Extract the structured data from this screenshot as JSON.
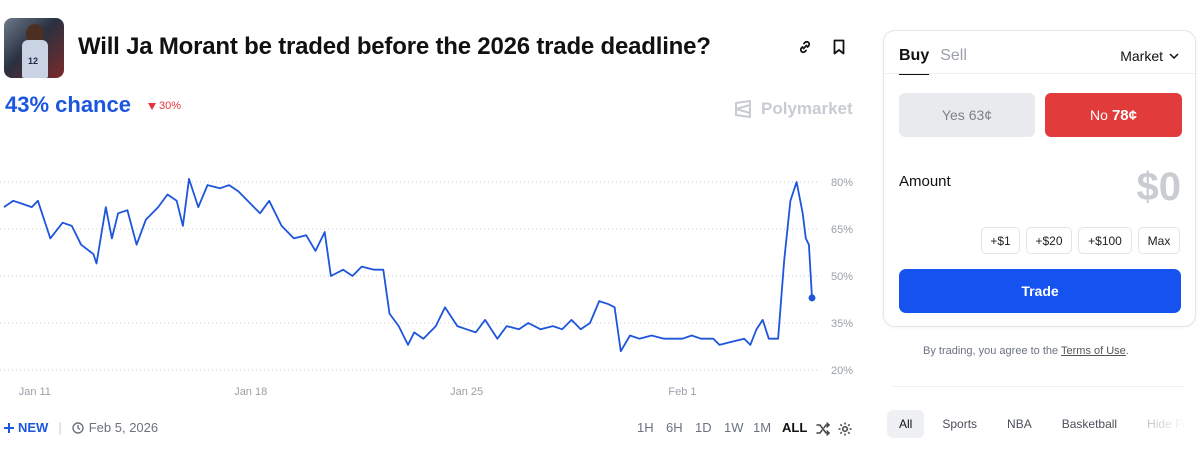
{
  "market": {
    "title": "Will Ja Morant be traded before the 2026 trade deadline?",
    "chance": "43% chance",
    "change": "30%",
    "brand": "Polymarket",
    "jersey_number": "12"
  },
  "footer": {
    "new_label": "NEW",
    "date": "Feb 5, 2026",
    "ranges": [
      "1H",
      "6H",
      "1D",
      "1W",
      "1M",
      "ALL"
    ],
    "active_range": "ALL"
  },
  "panel": {
    "buy": "Buy",
    "sell": "Sell",
    "order_type": "Market",
    "yes_label": "Yes",
    "yes_price": "63¢",
    "no_label": "No",
    "no_price": "78¢",
    "amount_label": "Amount",
    "amount_value": "$0",
    "quick_amounts": [
      "+$1",
      "+$20",
      "+$100",
      "Max"
    ],
    "trade_label": "Trade"
  },
  "terms": {
    "text": "By trading, you agree to the ",
    "link": "Terms of Use",
    "period": "."
  },
  "categories": [
    "All",
    "Sports",
    "NBA",
    "Basketball",
    "Hide Fr"
  ],
  "colors": {
    "accent": "#1b56e0",
    "trade_button": "#1652f0",
    "no_button": "#e23b3b",
    "down": "#e3343a"
  },
  "icons": {
    "link": "link-icon",
    "bookmark": "bookmark-icon",
    "brand": "polymarket-logo-icon",
    "shuffle": "shuffle-icon",
    "settings": "gear-icon",
    "clock": "clock-icon",
    "chevron": "chevron-down-icon"
  },
  "chart_data": {
    "type": "line",
    "x_ticks": [
      "Jan 11",
      "Jan 18",
      "Jan 25",
      "Feb 1"
    ],
    "y_ticks": [
      "80%",
      "65%",
      "50%",
      "35%",
      "20%"
    ],
    "ylim": [
      20,
      80
    ],
    "grid": true,
    "series": [
      {
        "points": [
          [
            "Jan 10",
            72
          ],
          [
            "Jan 10.3",
            74
          ],
          [
            "Jan 10.6",
            73
          ],
          [
            "Jan 10.9",
            72
          ],
          [
            "Jan 11.1",
            74
          ],
          [
            "Jan 11.5",
            62
          ],
          [
            "Jan 11.9",
            67
          ],
          [
            "Jan 12.2",
            66
          ],
          [
            "Jan 12.5",
            60
          ],
          [
            "Jan 12.9",
            57
          ],
          [
            "Jan 13",
            54
          ],
          [
            "Jan 13.3",
            72
          ],
          [
            "Jan 13.5",
            62
          ],
          [
            "Jan 13.7",
            70
          ],
          [
            "Jan 14",
            71
          ],
          [
            "Jan 14.3",
            60
          ],
          [
            "Jan 14.6",
            68
          ],
          [
            "Jan 15",
            72
          ],
          [
            "Jan 15.3",
            76
          ],
          [
            "Jan 15.6",
            74
          ],
          [
            "Jan 15.8",
            66
          ],
          [
            "Jan 16",
            81
          ],
          [
            "Jan 16.3",
            72
          ],
          [
            "Jan 16.6",
            79
          ],
          [
            "Jan 17",
            78
          ],
          [
            "Jan 17.3",
            79
          ],
          [
            "Jan 17.6",
            77
          ],
          [
            "Jan 18",
            73
          ],
          [
            "Jan 18.3",
            70
          ],
          [
            "Jan 18.6",
            74
          ],
          [
            "Jan 19",
            66
          ],
          [
            "Jan 19.4",
            62
          ],
          [
            "Jan 19.8",
            63
          ],
          [
            "Jan 20.1",
            58
          ],
          [
            "Jan 20.4",
            64
          ],
          [
            "Jan 20.6",
            50
          ],
          [
            "Jan 21",
            52
          ],
          [
            "Jan 21.3",
            50
          ],
          [
            "Jan 21.6",
            53
          ],
          [
            "Jan 22",
            52
          ],
          [
            "Jan 22.3",
            52
          ],
          [
            "Jan 22.5",
            38
          ],
          [
            "Jan 22.8",
            34
          ],
          [
            "Jan 23.1",
            28
          ],
          [
            "Jan 23.3",
            32
          ],
          [
            "Jan 23.6",
            30
          ],
          [
            "Jan 24",
            34
          ],
          [
            "Jan 24.3",
            40
          ],
          [
            "Jan 24.7",
            34
          ],
          [
            "Jan 25",
            33
          ],
          [
            "Jan 25.3",
            32
          ],
          [
            "Jan 25.6",
            36
          ],
          [
            "Jan 26",
            30
          ],
          [
            "Jan 26.3",
            34
          ],
          [
            "Jan 26.7",
            33
          ],
          [
            "Jan 27",
            35
          ],
          [
            "Jan 27.4",
            33
          ],
          [
            "Jan 27.8",
            34
          ],
          [
            "Jan 28.1",
            33
          ],
          [
            "Jan 28.4",
            36
          ],
          [
            "Jan 28.7",
            33
          ],
          [
            "Jan 29",
            35
          ],
          [
            "Jan 29.3",
            42
          ],
          [
            "Jan 29.6",
            41
          ],
          [
            "Jan 29.8",
            40
          ],
          [
            "Jan 30",
            26
          ],
          [
            "Jan 30.3",
            31
          ],
          [
            "Jan 30.6",
            30
          ],
          [
            "Jan 31",
            31
          ],
          [
            "Jan 31.4",
            30
          ],
          [
            "Feb 1",
            30
          ],
          [
            "Feb 1.3",
            31
          ],
          [
            "Feb 1.6",
            30
          ],
          [
            "Feb 2",
            30
          ],
          [
            "Feb 2.2",
            28
          ],
          [
            "Feb 2.6",
            29
          ],
          [
            "Feb 3",
            30
          ],
          [
            "Feb 3.2",
            28
          ],
          [
            "Feb 3.4",
            33
          ],
          [
            "Feb 3.6",
            36
          ],
          [
            "Feb 3.8",
            30
          ],
          [
            "Feb 4.1",
            30
          ],
          [
            "Feb 4.3",
            55
          ],
          [
            "Feb 4.5",
            74
          ],
          [
            "Feb 4.7",
            80
          ],
          [
            "Feb 4.9",
            70
          ],
          [
            "Feb 5",
            62
          ],
          [
            "Feb 5.1",
            60
          ],
          [
            "Feb 5.2",
            43
          ]
        ]
      }
    ]
  }
}
